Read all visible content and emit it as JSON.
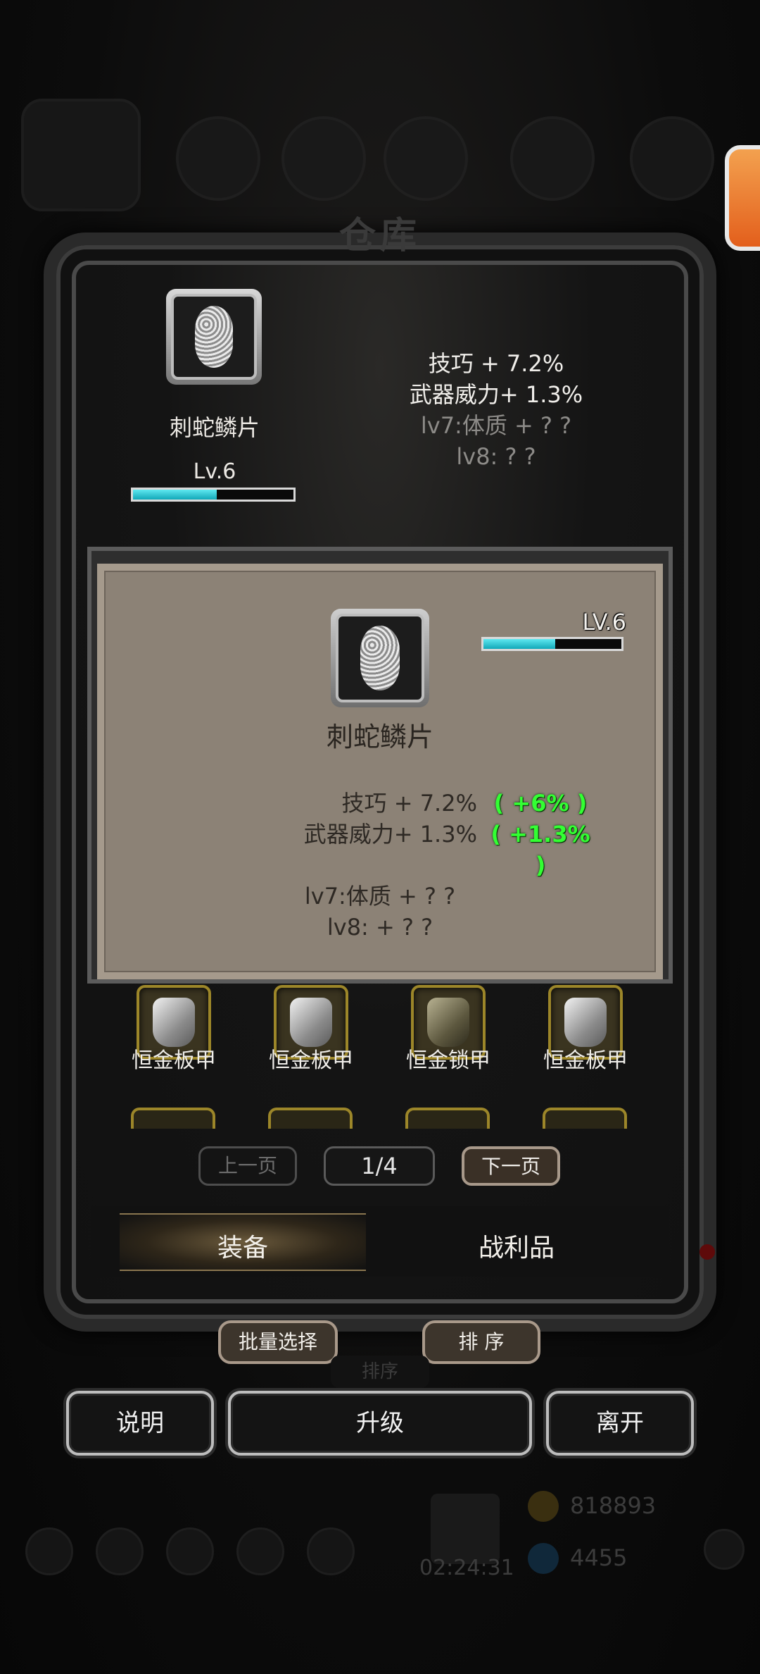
{
  "window": {
    "title": "仓库"
  },
  "selected_item": {
    "name": "刺蛇鳞片",
    "level_label": "Lv.6",
    "progress": 0.52,
    "stats": [
      "技巧 + 7.2%",
      "武器威力+ 1.3%"
    ],
    "locked_stats": [
      "lv7:体质 + ? ?",
      "lv8: ? ?"
    ]
  },
  "detail_card": {
    "name": "刺蛇鳞片",
    "level_label": "LV.6",
    "progress": 0.52,
    "stats": [
      "技巧 + 7.2%",
      "武器威力+ 1.3%"
    ],
    "bonuses": [
      "( +6% )",
      "( +1.3% )"
    ],
    "locked_stats": [
      "lv7:体质 + ? ?",
      "lv8: + ? ?"
    ]
  },
  "inventory": {
    "row1": [
      {
        "label": "恒金板甲",
        "icon": "plate-armor-icon"
      },
      {
        "label": "恒金板甲",
        "icon": "plate-armor-icon"
      },
      {
        "label": "恒金锁甲",
        "icon": "chain-armor-icon"
      },
      {
        "label": "恒金板甲",
        "icon": "plate-armor-icon"
      }
    ]
  },
  "pager": {
    "prev": "上一页",
    "page": "1/4",
    "next": "下一页"
  },
  "tabs": {
    "equipment": "装备",
    "loot": "战利品"
  },
  "actions": {
    "batch_select": "批量选择",
    "sort": "排 序",
    "sort_bg": "排序"
  },
  "bottom_buttons": {
    "help": "说明",
    "upgrade": "升级",
    "leave": "离开"
  },
  "background_hud": {
    "gold": "818893",
    "gems": "4455",
    "timer": "02:24:31"
  },
  "colors": {
    "accent_bar": "#11a8b8",
    "bonus_green": "#33ff33",
    "card_bg": "#8c8276"
  }
}
